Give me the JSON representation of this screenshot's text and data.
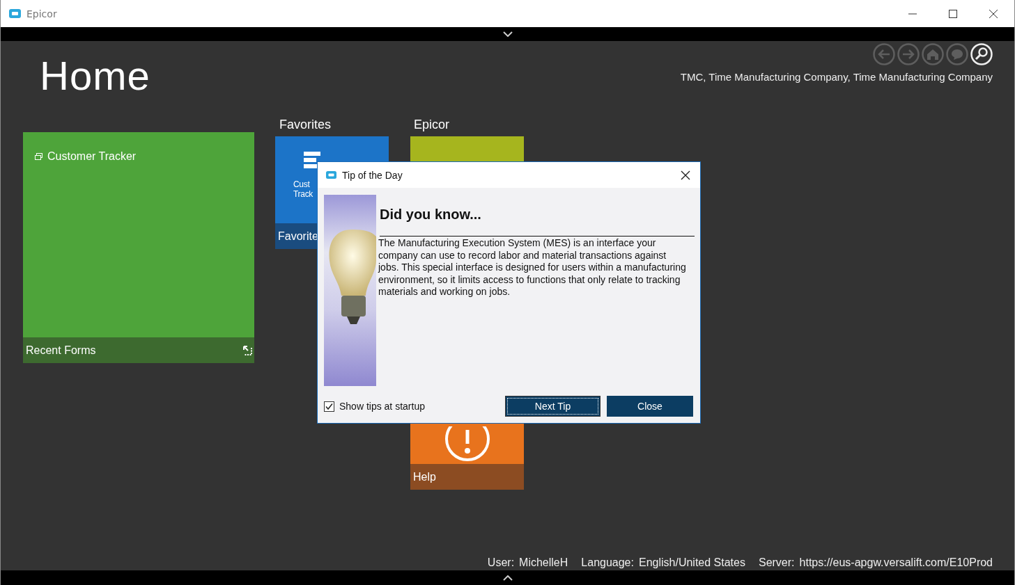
{
  "window": {
    "title": "Epicor"
  },
  "header": {
    "title": "Home",
    "company": "TMC, Time Manufacturing Company, Time Manufacturing Company"
  },
  "nav_buttons": [
    {
      "kind": "back",
      "disabled": true
    },
    {
      "kind": "forward",
      "disabled": true
    },
    {
      "kind": "home",
      "disabled": true
    },
    {
      "kind": "chat",
      "disabled": true
    },
    {
      "kind": "search",
      "disabled": false
    }
  ],
  "recent": {
    "item": "Customer Tracker",
    "footer": "Recent Forms"
  },
  "groups": [
    {
      "title": "Favorites",
      "tile_lines": [
        "Cust",
        "Track"
      ],
      "footer": "Favorite"
    },
    {
      "title": "Epicor",
      "footer": "Help"
    }
  ],
  "dialog": {
    "title": "Tip of the Day",
    "heading": "Did you know...",
    "text": "The Manufacturing Execution System (MES) is an interface your company can use to record labor and material transactions against jobs. This special interface is designed for users within a manufacturing environment, so it limits access to functions that only relate to tracking materials and working on jobs.",
    "checkbox": {
      "label": "Show tips at startup",
      "checked": true
    },
    "buttons": [
      {
        "label": "Next Tip",
        "focused": true
      },
      {
        "label": "Close",
        "focused": false
      }
    ]
  },
  "status_bar": [
    {
      "label": "User:",
      "value": "MichelleH"
    },
    {
      "label": "Language:",
      "value": "English/United States"
    },
    {
      "label": "Server:",
      "value": "https://eus-apgw.versalift.com/E10Prod"
    }
  ]
}
